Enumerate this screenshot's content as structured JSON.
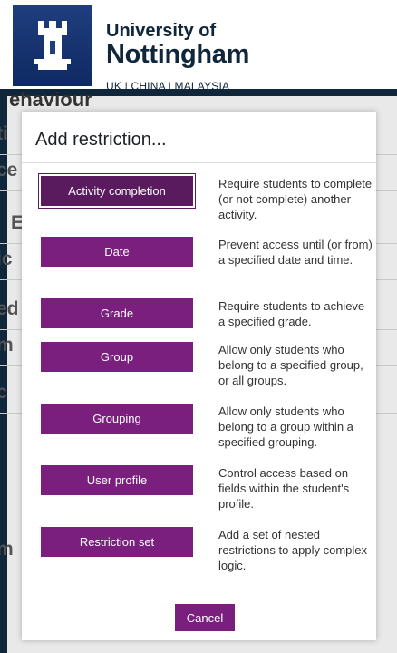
{
  "header": {
    "brand_line1": "University of",
    "brand_line2": "Nottingham",
    "brand_line3": "UK | CHINA | MALAYSIA"
  },
  "background": {
    "heading": "ehaviour",
    "rows": [
      "ti",
      "ce",
      "E",
      "ic",
      "ed",
      "m",
      "c",
      "m"
    ]
  },
  "modal": {
    "title": "Add restriction...",
    "options": [
      {
        "label": "Activity completion",
        "description": "Require students to complete (or not complete) another activity."
      },
      {
        "label": "Date",
        "description": "Prevent access until (or from) a specified date and time."
      },
      {
        "label": "Grade",
        "description": "Require students to achieve a specified grade."
      },
      {
        "label": "Group",
        "description": "Allow only students who belong to a specified group, or all groups."
      },
      {
        "label": "Grouping",
        "description": "Allow only students who belong to a group within a specified grouping."
      },
      {
        "label": "User profile",
        "description": "Control access based on fields within the student's profile."
      },
      {
        "label": "Restriction set",
        "description": "Add a set of nested restrictions to apply complex logic."
      }
    ],
    "cancel_label": "Cancel"
  },
  "colors": {
    "brand_navy": "#10263b",
    "logo_blue": "#1f3e7e",
    "button_purple": "#7a1f7e"
  }
}
